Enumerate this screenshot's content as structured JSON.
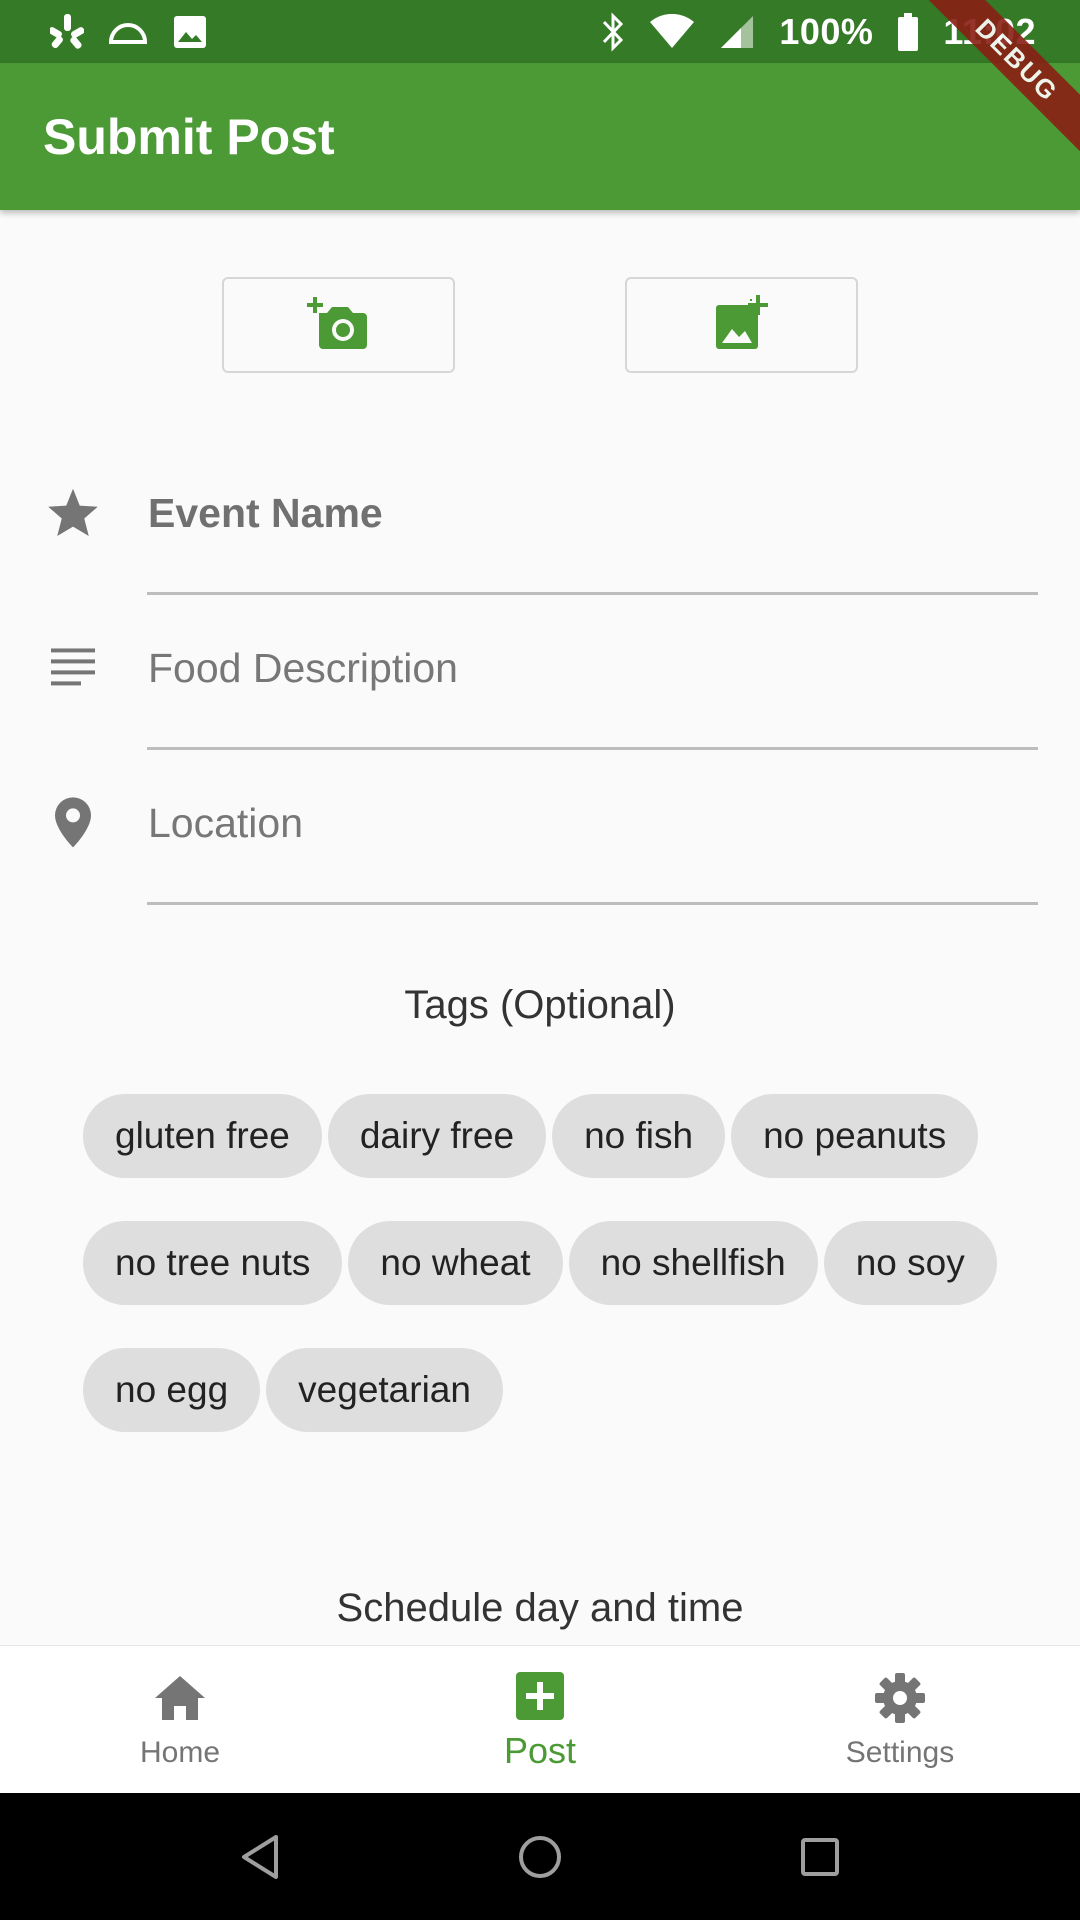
{
  "status_bar": {
    "battery": "100%",
    "time": "11:02",
    "left_icons": [
      "yelp-icon",
      "arc-icon",
      "image-icon"
    ],
    "right_icons": [
      "bluetooth-icon",
      "wifi-icon",
      "signal-icon",
      "battery-icon"
    ]
  },
  "debug_banner": "DEBUG",
  "app_bar": {
    "title": "Submit Post"
  },
  "photo_buttons": {
    "camera_icon": "add-a-photo-icon",
    "gallery_icon": "add-photo-alternate-icon"
  },
  "form": {
    "event_name": {
      "placeholder": "Event Name",
      "icon": "star-icon"
    },
    "food_description": {
      "placeholder": "Food Description",
      "icon": "notes-icon"
    },
    "location": {
      "placeholder": "Location",
      "icon": "location-pin-icon"
    }
  },
  "tags": {
    "title": "Tags (Optional)",
    "items": [
      "gluten free",
      "dairy free",
      "no fish",
      "no peanuts",
      "no tree nuts",
      "no wheat",
      "no shellfish",
      "no soy",
      "no egg",
      "vegetarian"
    ]
  },
  "schedule": {
    "title": "Schedule day and time"
  },
  "bottom_nav": {
    "items": [
      {
        "label": "Home",
        "icon": "home-icon",
        "active": false
      },
      {
        "label": "Post",
        "icon": "add-box-icon",
        "active": true
      },
      {
        "label": "Settings",
        "icon": "gear-icon",
        "active": false
      }
    ]
  },
  "colors": {
    "primary": "#4c9a36",
    "primary_dark": "#357a27",
    "chip_bg": "#dedede",
    "icon_grey": "#757575"
  }
}
